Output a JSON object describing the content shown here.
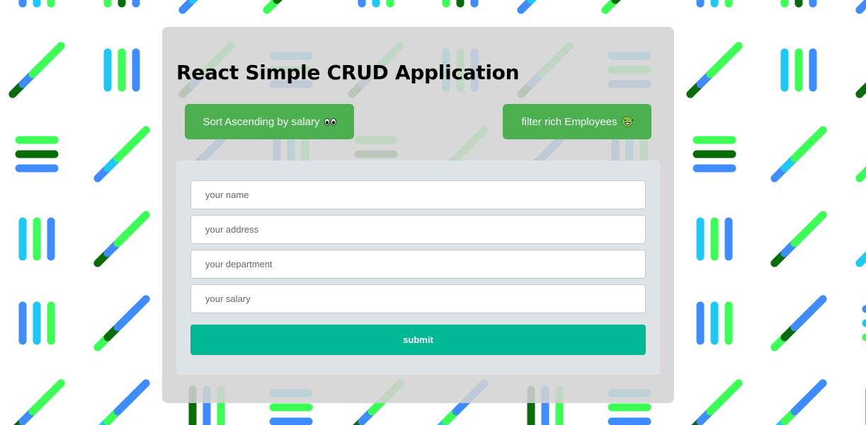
{
  "app": {
    "title": "React Simple CRUD Application"
  },
  "toolbar": {
    "sort_label": "Sort Ascending by salary",
    "sort_icon": "eyes-emoji",
    "filter_label": "filter rich Employees",
    "filter_icon": "money-mouth-face-emoji"
  },
  "form": {
    "name_placeholder": "your name",
    "address_placeholder": "your address",
    "department_placeholder": "your department",
    "salary_placeholder": "your salary",
    "submit_label": "submit"
  },
  "colors": {
    "button_green": "#4caf50",
    "submit_teal": "#00b894",
    "pattern_blue": "#3f8cff",
    "pattern_cyan": "#1ec8f5",
    "pattern_lime": "#3cff55",
    "pattern_dark_green": "#0a6b0a"
  }
}
